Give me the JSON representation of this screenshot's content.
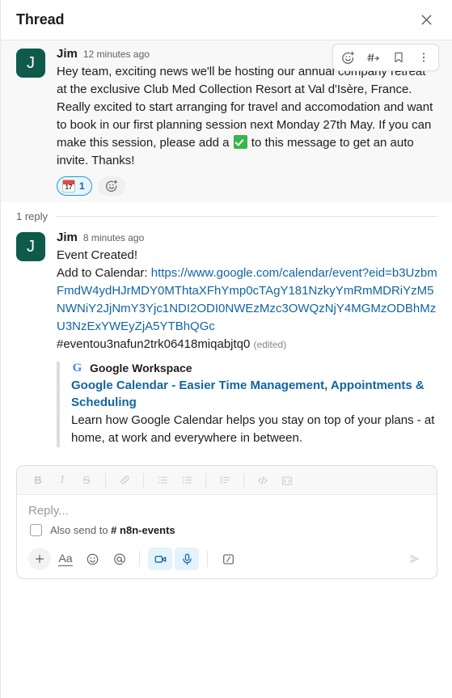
{
  "header": {
    "title": "Thread",
    "close_label": "Close"
  },
  "hover_actions": [
    {
      "name": "add-reaction",
      "label": "Add reaction"
    },
    {
      "name": "share-message",
      "label": "Share message"
    },
    {
      "name": "save-message",
      "label": "Save for later"
    },
    {
      "name": "more-actions",
      "label": "More actions"
    }
  ],
  "root_message": {
    "avatar_initial": "J",
    "avatar_color": "#0e5b4c",
    "author": "Jim",
    "timestamp": "12 minutes ago",
    "text_part1": "Hey team, exciting news we'll be hosting our annual company retreat at the exclusive Club Med Collection Resort at Val d'Isère, France. Really excited to start arranging for travel and accomodation and want to book in our first planning session next Monday 27th May. If you can make this session, please add a ",
    "inline_emoji": "white-check-mark",
    "text_part2": " to this message to get an auto invite. Thanks!",
    "reactions": [
      {
        "emoji": "calendar",
        "day": "17",
        "count": "1",
        "selected": true
      }
    ],
    "add_reaction_label": "Add reaction"
  },
  "reply_divider": {
    "count_label": "1 reply"
  },
  "reply_message": {
    "avatar_initial": "J",
    "author": "Jim",
    "timestamp": "8 minutes ago",
    "line1": "Event Created!",
    "line2_prefix": "Add to Calendar: ",
    "calendar_url": "https://www.google.com/calendar/event?eid=b3UzbmFmdW4ydHJrMDY0MThtaXFhYmp0cTAgY181NzkyYmRmMDRiYzM5NWNiY2JjNmY3Yjc1NDI2ODI0NWEzMzc3OWQzNjY4MGMzODBhMzU3NzExYWEyZjA5YTBhQGc",
    "hashtag": "#eventou3nafun2trk06418miqabjtq0",
    "edited_label": "(edited)",
    "unfurl": {
      "service_icon": "google-logo",
      "service_name": "Google Workspace",
      "title": "Google Calendar - Easier Time Management, Appointments & Scheduling",
      "description": "Learn how Google Calendar helps you stay on top of your plans - at home, at work and everywhere in between."
    }
  },
  "composer": {
    "format_buttons": [
      {
        "name": "bold",
        "glyph": "B"
      },
      {
        "name": "italic",
        "glyph": "I"
      },
      {
        "name": "strikethrough",
        "glyph": "S"
      },
      {
        "name": "link",
        "glyph": "link"
      },
      {
        "name": "ordered-list",
        "glyph": "ol"
      },
      {
        "name": "bulleted-list",
        "glyph": "ul"
      },
      {
        "name": "blockquote",
        "glyph": "quote"
      },
      {
        "name": "code",
        "glyph": "code"
      },
      {
        "name": "code-block",
        "glyph": "code-block"
      }
    ],
    "placeholder": "Reply...",
    "also_send_label": "Also send to",
    "also_send_channel": "n8n-events",
    "channel_prefix": "#",
    "bottom_buttons": [
      {
        "name": "add-attachment",
        "glyph": "plus"
      },
      {
        "name": "formatting",
        "glyph": "Aa"
      },
      {
        "name": "emoji",
        "glyph": "smiley"
      },
      {
        "name": "mention",
        "glyph": "at"
      },
      {
        "name": "video-clip",
        "glyph": "video",
        "active": true
      },
      {
        "name": "audio-clip",
        "glyph": "mic",
        "active": true
      },
      {
        "name": "slash-command",
        "glyph": "slash"
      }
    ],
    "send_label": "Send"
  }
}
